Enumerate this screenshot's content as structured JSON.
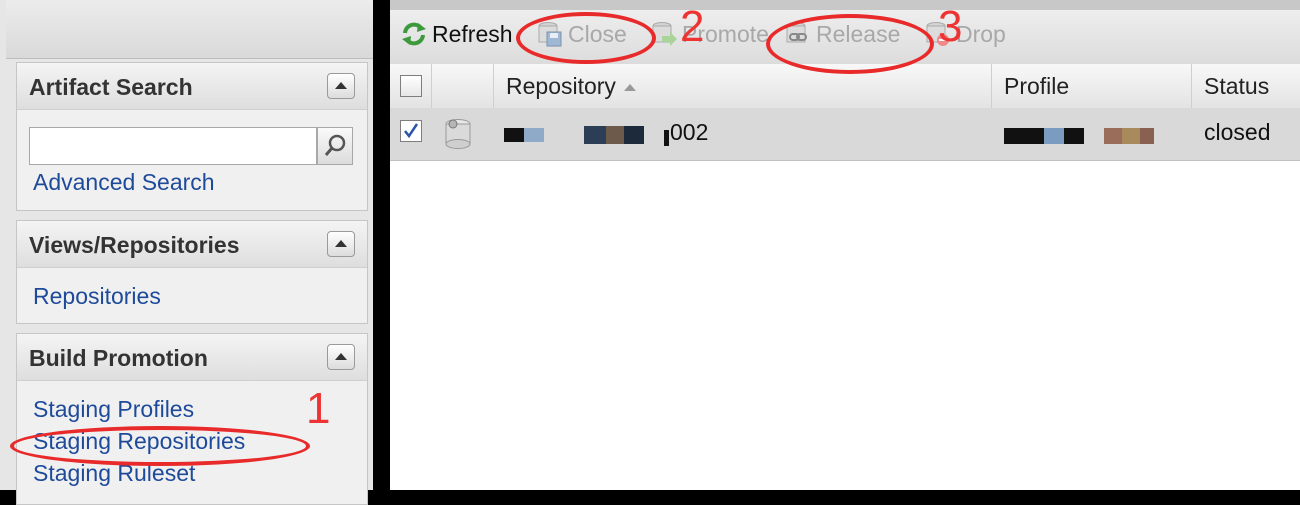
{
  "sidebar": {
    "artifact_search": {
      "title": "Artifact Search",
      "search_value": "",
      "advanced_link": "Advanced Search"
    },
    "views": {
      "title": "Views/Repositories",
      "items": [
        "Repositories"
      ]
    },
    "build_promotion": {
      "title": "Build Promotion",
      "items": [
        "Staging Profiles",
        "Staging Repositories",
        "Staging Ruleset"
      ]
    }
  },
  "toolbar": {
    "refresh": "Refresh",
    "close": "Close",
    "promote": "Promote",
    "release": "Release",
    "drop": "Drop"
  },
  "grid": {
    "columns": {
      "repository": "Repository",
      "profile": "Profile",
      "status": "Status"
    },
    "rows": [
      {
        "selected": true,
        "repository_suffix": "002",
        "status": "closed"
      }
    ]
  },
  "annotations": [
    "1",
    "2",
    "3"
  ],
  "colors": {
    "link": "#1e4a9a",
    "annotation": "#e82a2a",
    "selected_row": "#d9d9d9"
  }
}
